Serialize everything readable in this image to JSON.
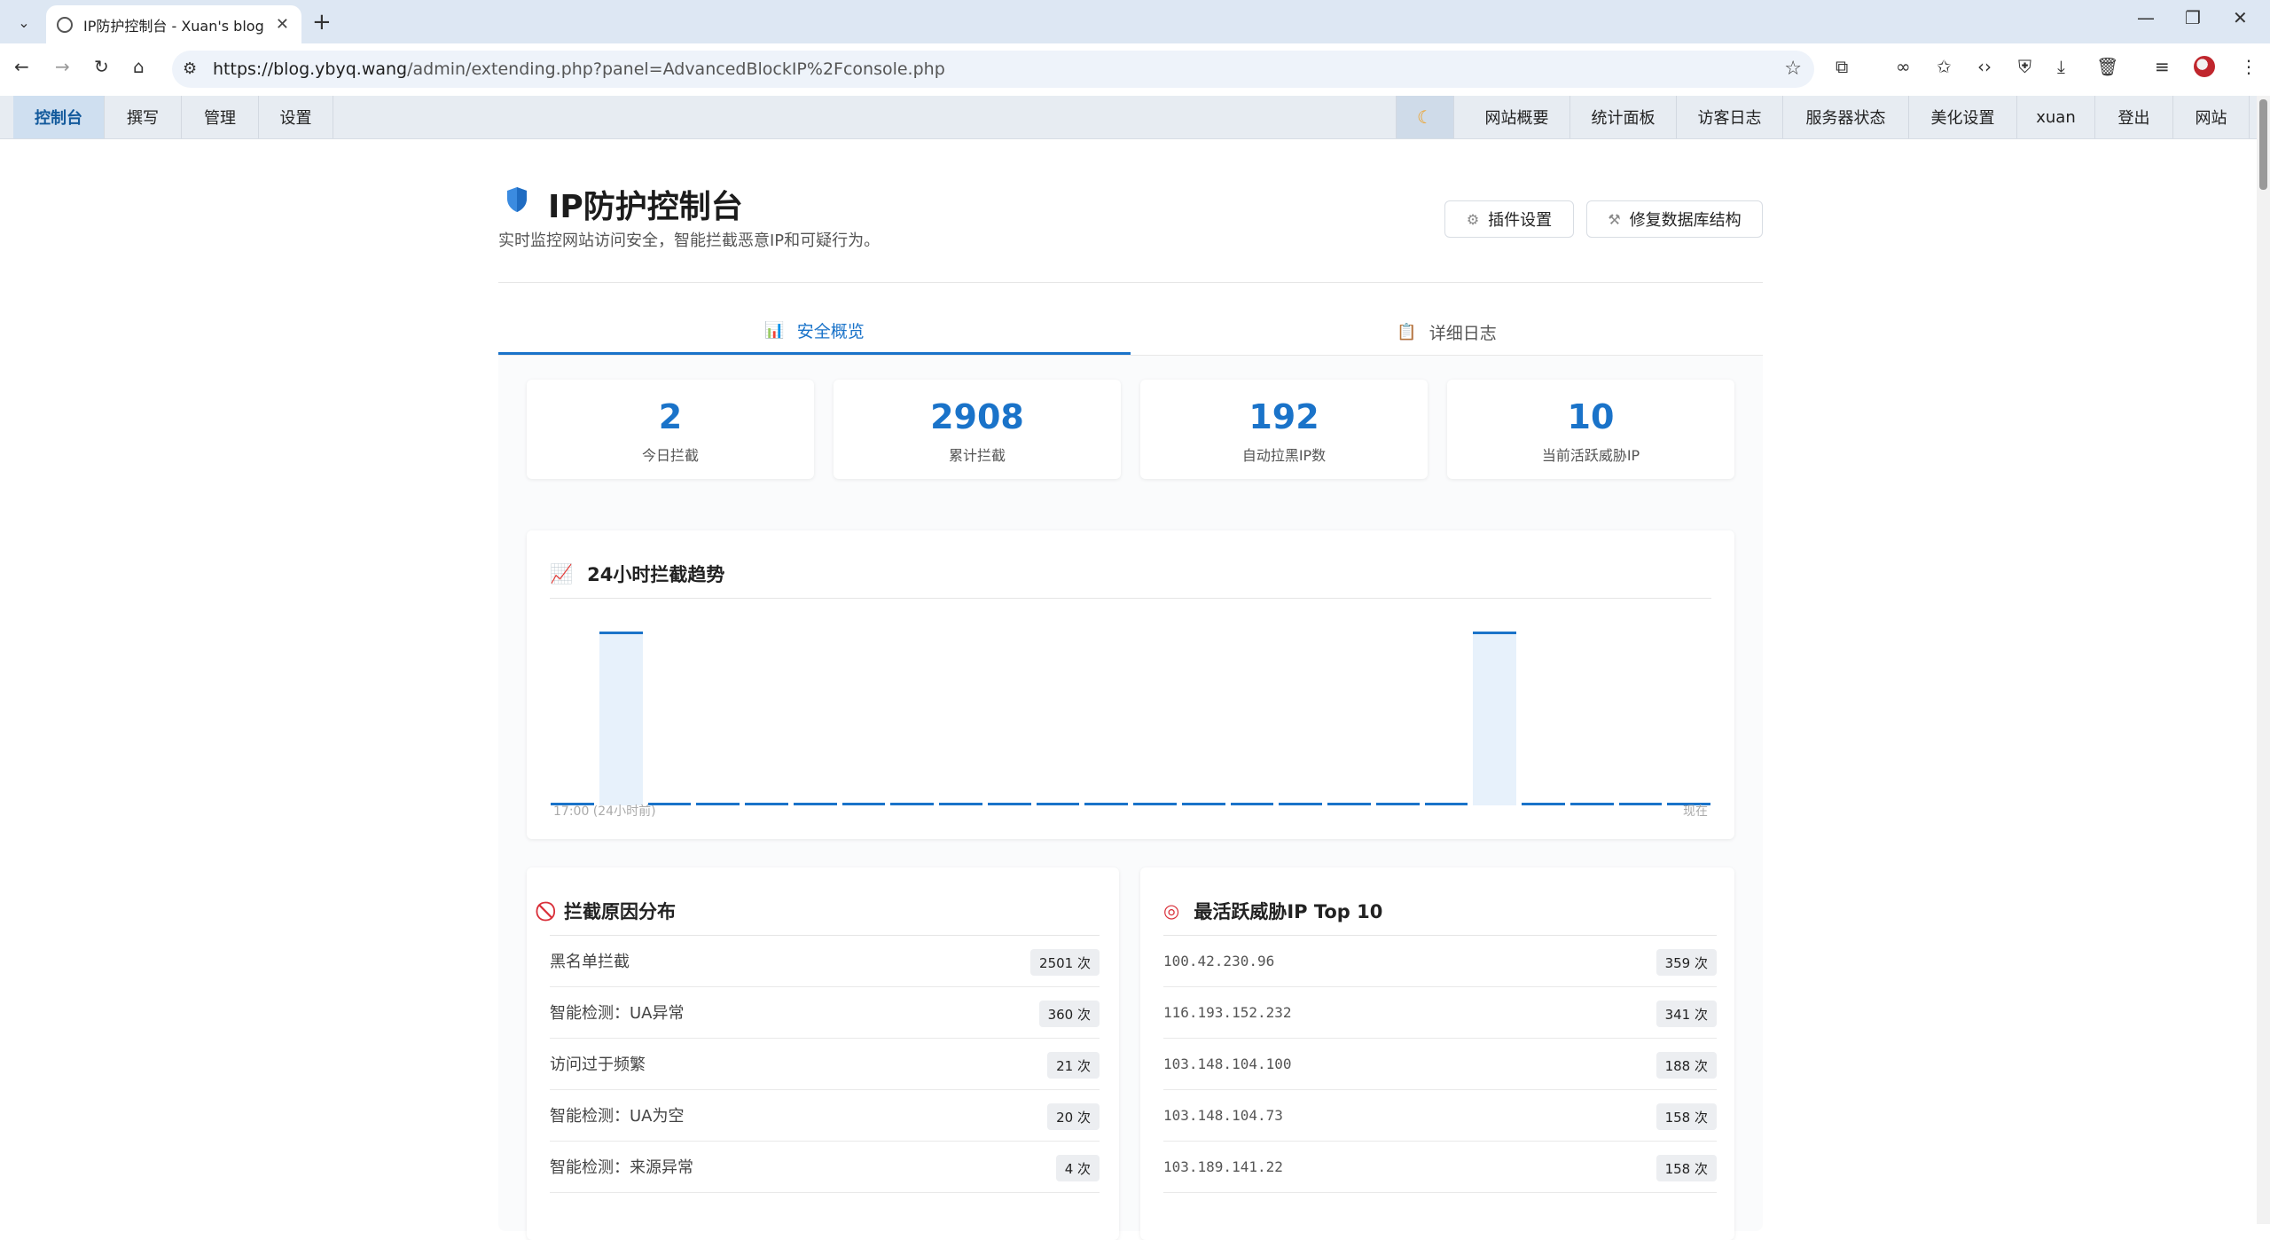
{
  "browser": {
    "tab_title": "IP防护控制台 - Xuan's blog",
    "url_host": "https://blog.ybyq.wang",
    "url_path": "/admin/extending.php?panel=AdvancedBlockIP%2Fconsole.php"
  },
  "admin_nav": {
    "left": [
      "控制台",
      "撰写",
      "管理",
      "设置"
    ],
    "right": [
      "网站概要",
      "统计面板",
      "访客日志",
      "服务器状态",
      "美化设置",
      "xuan",
      "登出",
      "网站"
    ],
    "theme_icon": "moon-icon"
  },
  "header": {
    "title": "IP防护控制台",
    "subtitle": "实时监控网站访问安全，智能拦截恶意IP和可疑行为。",
    "settings_button": "插件设置",
    "repair_button": "修复数据库结构"
  },
  "tabs": [
    {
      "label": "安全概览",
      "icon": "bar-chart-icon",
      "active": true
    },
    {
      "label": "详细日志",
      "icon": "clipboard-icon",
      "active": false
    }
  ],
  "stats": [
    {
      "value": "2",
      "label": "今日拦截"
    },
    {
      "value": "2908",
      "label": "累计拦截"
    },
    {
      "value": "192",
      "label": "自动拉黑IP数"
    },
    {
      "value": "10",
      "label": "当前活跃威胁IP"
    }
  ],
  "trend": {
    "title": "24小时拦截趋势",
    "start_label": "17:00 (24小时前)",
    "end_label": "现在"
  },
  "chart_data": {
    "type": "bar",
    "title": "24小时拦截趋势",
    "values": [
      0,
      1,
      0,
      0,
      0,
      0,
      0,
      0,
      0,
      0,
      0,
      0,
      0,
      0,
      0,
      0,
      0,
      0,
      0,
      1,
      0,
      0,
      0,
      0
    ],
    "xlabel": "",
    "ylabel": ""
  },
  "reasons": {
    "title": "拦截原因分布",
    "items": [
      {
        "name": "黑名单拦截",
        "count": "2501 次"
      },
      {
        "name": "智能检测：UA异常",
        "count": "360 次"
      },
      {
        "name": "访问过于频繁",
        "count": "21 次"
      },
      {
        "name": "智能检测：UA为空",
        "count": "20 次"
      },
      {
        "name": "智能检测：来源异常",
        "count": "4 次"
      }
    ]
  },
  "top_ips": {
    "title": "最活跃威胁IP Top 10",
    "items": [
      {
        "ip": "100.42.230.96",
        "count": "359 次"
      },
      {
        "ip": "116.193.152.232",
        "count": "341 次"
      },
      {
        "ip": "103.148.104.100",
        "count": "188 次"
      },
      {
        "ip": "103.148.104.73",
        "count": "158 次"
      },
      {
        "ip": "103.189.141.22",
        "count": "158 次"
      }
    ]
  },
  "colors": {
    "accent": "#1a73c9",
    "bar_fill": "#e7f1fb"
  }
}
